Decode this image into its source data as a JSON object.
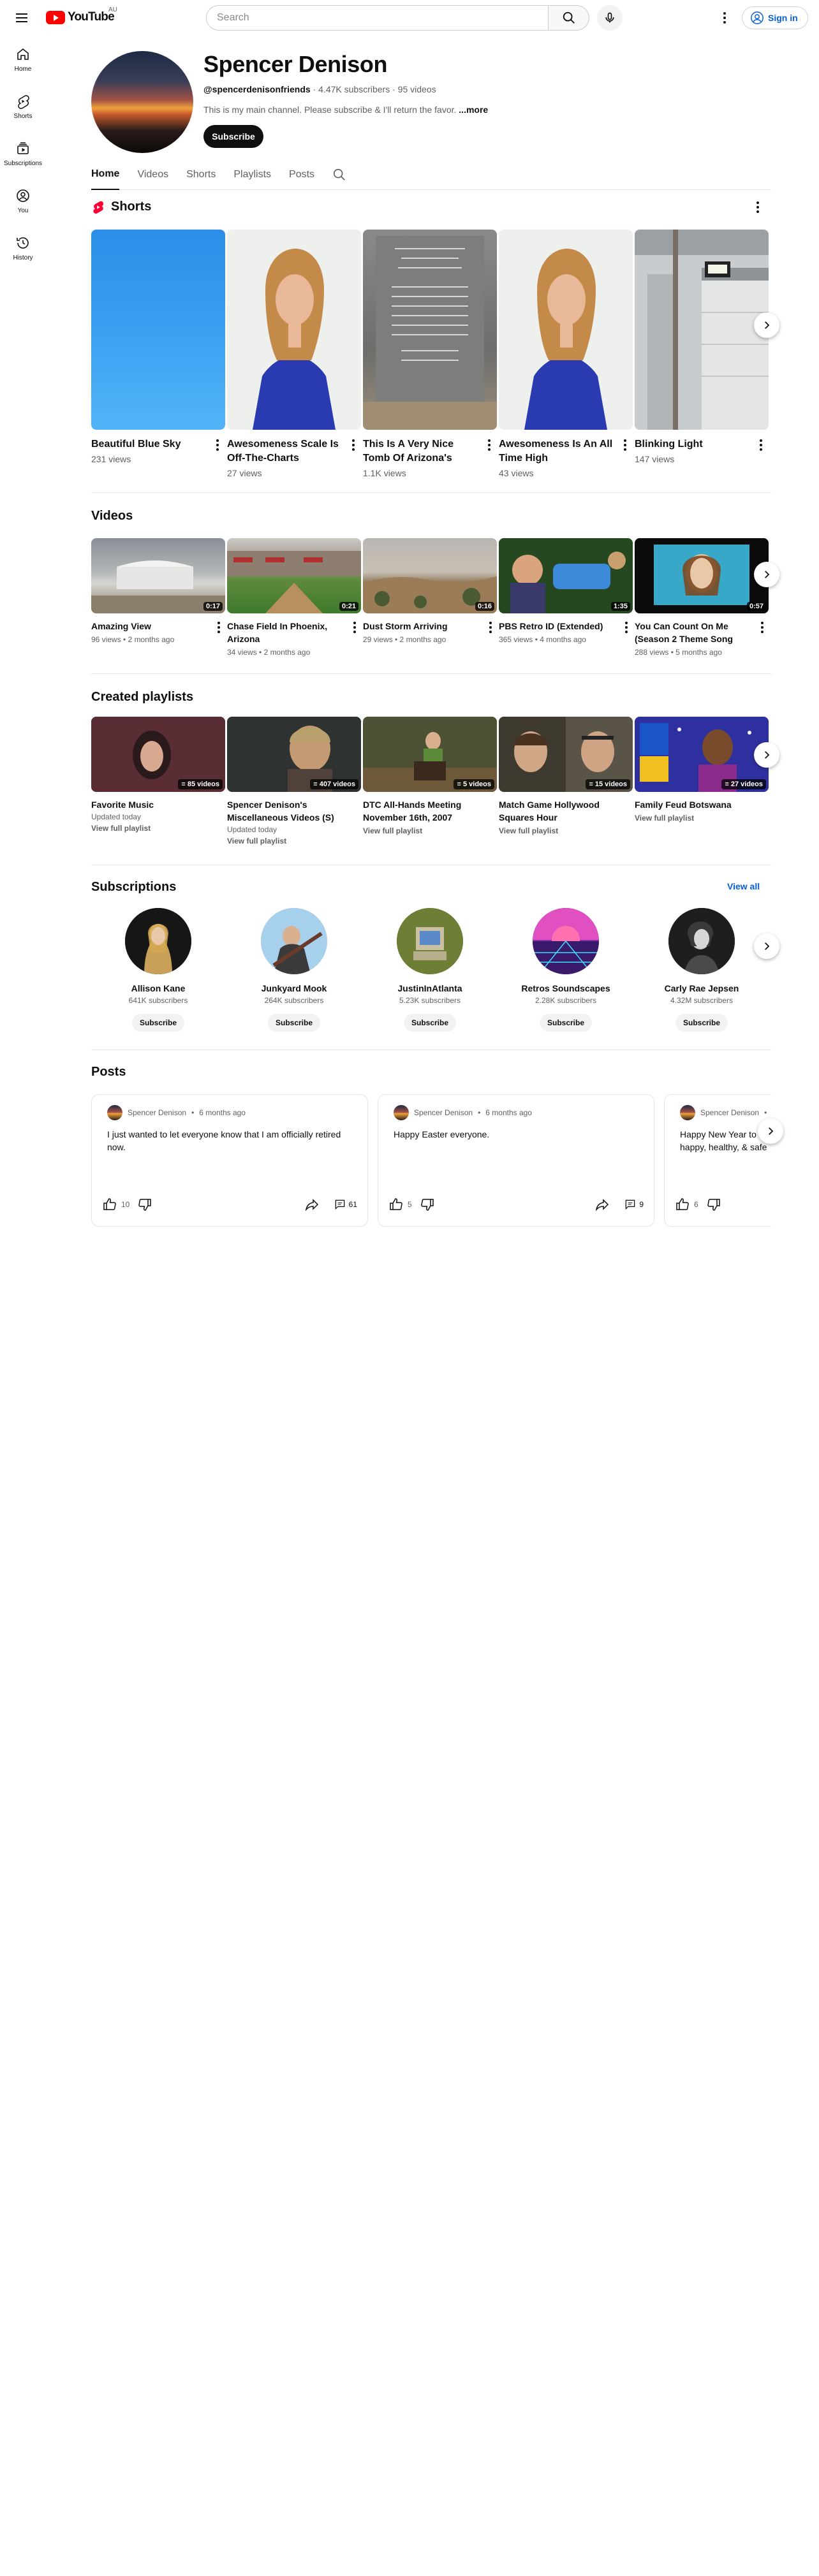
{
  "header": {
    "logo_text": "YouTube",
    "country": "AU",
    "search_placeholder": "Search",
    "signin_label": "Sign in"
  },
  "guide": [
    {
      "label": "Home",
      "icon": "home-icon"
    },
    {
      "label": "Shorts",
      "icon": "shorts-icon"
    },
    {
      "label": "Subscriptions",
      "icon": "subscriptions-icon"
    },
    {
      "label": "You",
      "icon": "you-icon"
    },
    {
      "label": "History",
      "icon": "history-icon"
    }
  ],
  "channel": {
    "name": "Spencer Denison",
    "handle": "@spencerdenisonfriends",
    "subscribers": "4.47K subscribers",
    "videos": "95 videos",
    "description": "This is my main channel. Please subscribe & I'll return the favor.",
    "more_label": "...more",
    "subscribe_label": "Subscribe"
  },
  "tabs": [
    "Home",
    "Videos",
    "Shorts",
    "Playlists",
    "Posts"
  ],
  "shorts": {
    "title": "Shorts",
    "items": [
      {
        "title": "Beautiful Blue Sky",
        "views": "231 views"
      },
      {
        "title": "Awesomeness Scale Is Off-The-Charts",
        "views": "27 views"
      },
      {
        "title": "This Is A Very Nice Tomb Of Arizona's Ver...",
        "views": "1.1K views"
      },
      {
        "title": "Awesomeness Is An All Time High",
        "views": "43 views"
      },
      {
        "title": "Blinking Light",
        "views": "147 views"
      }
    ]
  },
  "videos": {
    "title": "Videos",
    "items": [
      {
        "title": "Amazing View",
        "meta": "96 views • 2 months ago",
        "duration": "0:17"
      },
      {
        "title": "Chase Field In Phoenix, Arizona",
        "meta": "34 views • 2 months ago",
        "duration": "0:21"
      },
      {
        "title": "Dust Storm Arriving",
        "meta": "29 views • 2 months ago",
        "duration": "0:16"
      },
      {
        "title": "PBS Retro ID (Extended)",
        "meta": "365 views • 4 months ago",
        "duration": "1:35"
      },
      {
        "title": "You Can Count On Me (Season 2 Theme Song Fro...",
        "meta": "288 views • 5 months ago",
        "duration": "0:57"
      }
    ]
  },
  "playlists": {
    "title": "Created playlists",
    "items": [
      {
        "title": "Favorite Music",
        "updated": "Updated today",
        "count": "85 videos",
        "link": "View full playlist"
      },
      {
        "title": "Spencer Denison's Miscellaneous Videos (S)",
        "updated": "Updated today",
        "count": "407 videos",
        "link": "View full playlist"
      },
      {
        "title": "DTC All-Hands Meeting November 16th, 2007",
        "updated": "",
        "count": "5 videos",
        "link": "View full playlist"
      },
      {
        "title": "Match Game Hollywood Squares Hour",
        "updated": "",
        "count": "15 videos",
        "link": "View full playlist"
      },
      {
        "title": "Family Feud Botswana",
        "updated": "",
        "count": "27 videos",
        "link": "View full playlist"
      }
    ]
  },
  "subscriptions": {
    "title": "Subscriptions",
    "view_all": "View all",
    "items": [
      {
        "name": "Allison Kane",
        "subs": "641K subscribers",
        "button": "Subscribe"
      },
      {
        "name": "Junkyard Mook",
        "subs": "264K subscribers",
        "button": "Subscribe"
      },
      {
        "name": "JustinInAtlanta",
        "subs": "5.23K subscribers",
        "button": "Subscribe"
      },
      {
        "name": "Retros Soundscapes",
        "subs": "2.28K subscribers",
        "button": "Subscribe"
      },
      {
        "name": "Carly Rae Jepsen",
        "subs": "4.32M subscribers",
        "button": "Subscribe"
      }
    ]
  },
  "posts": {
    "title": "Posts",
    "items": [
      {
        "author": "Spencer Denison",
        "age": "6 months ago",
        "text": "I just wanted to let everyone know that I am officially retired now.",
        "likes": "10",
        "comments": "61"
      },
      {
        "author": "Spencer Denison",
        "age": "6 months ago",
        "text": "Happy Easter everyone.",
        "likes": "5",
        "comments": "9"
      },
      {
        "author": "Spencer Denison",
        "age": "",
        "text": "Happy New Year to happy, healthy, & safe",
        "likes": "6",
        "comments": ""
      }
    ]
  }
}
